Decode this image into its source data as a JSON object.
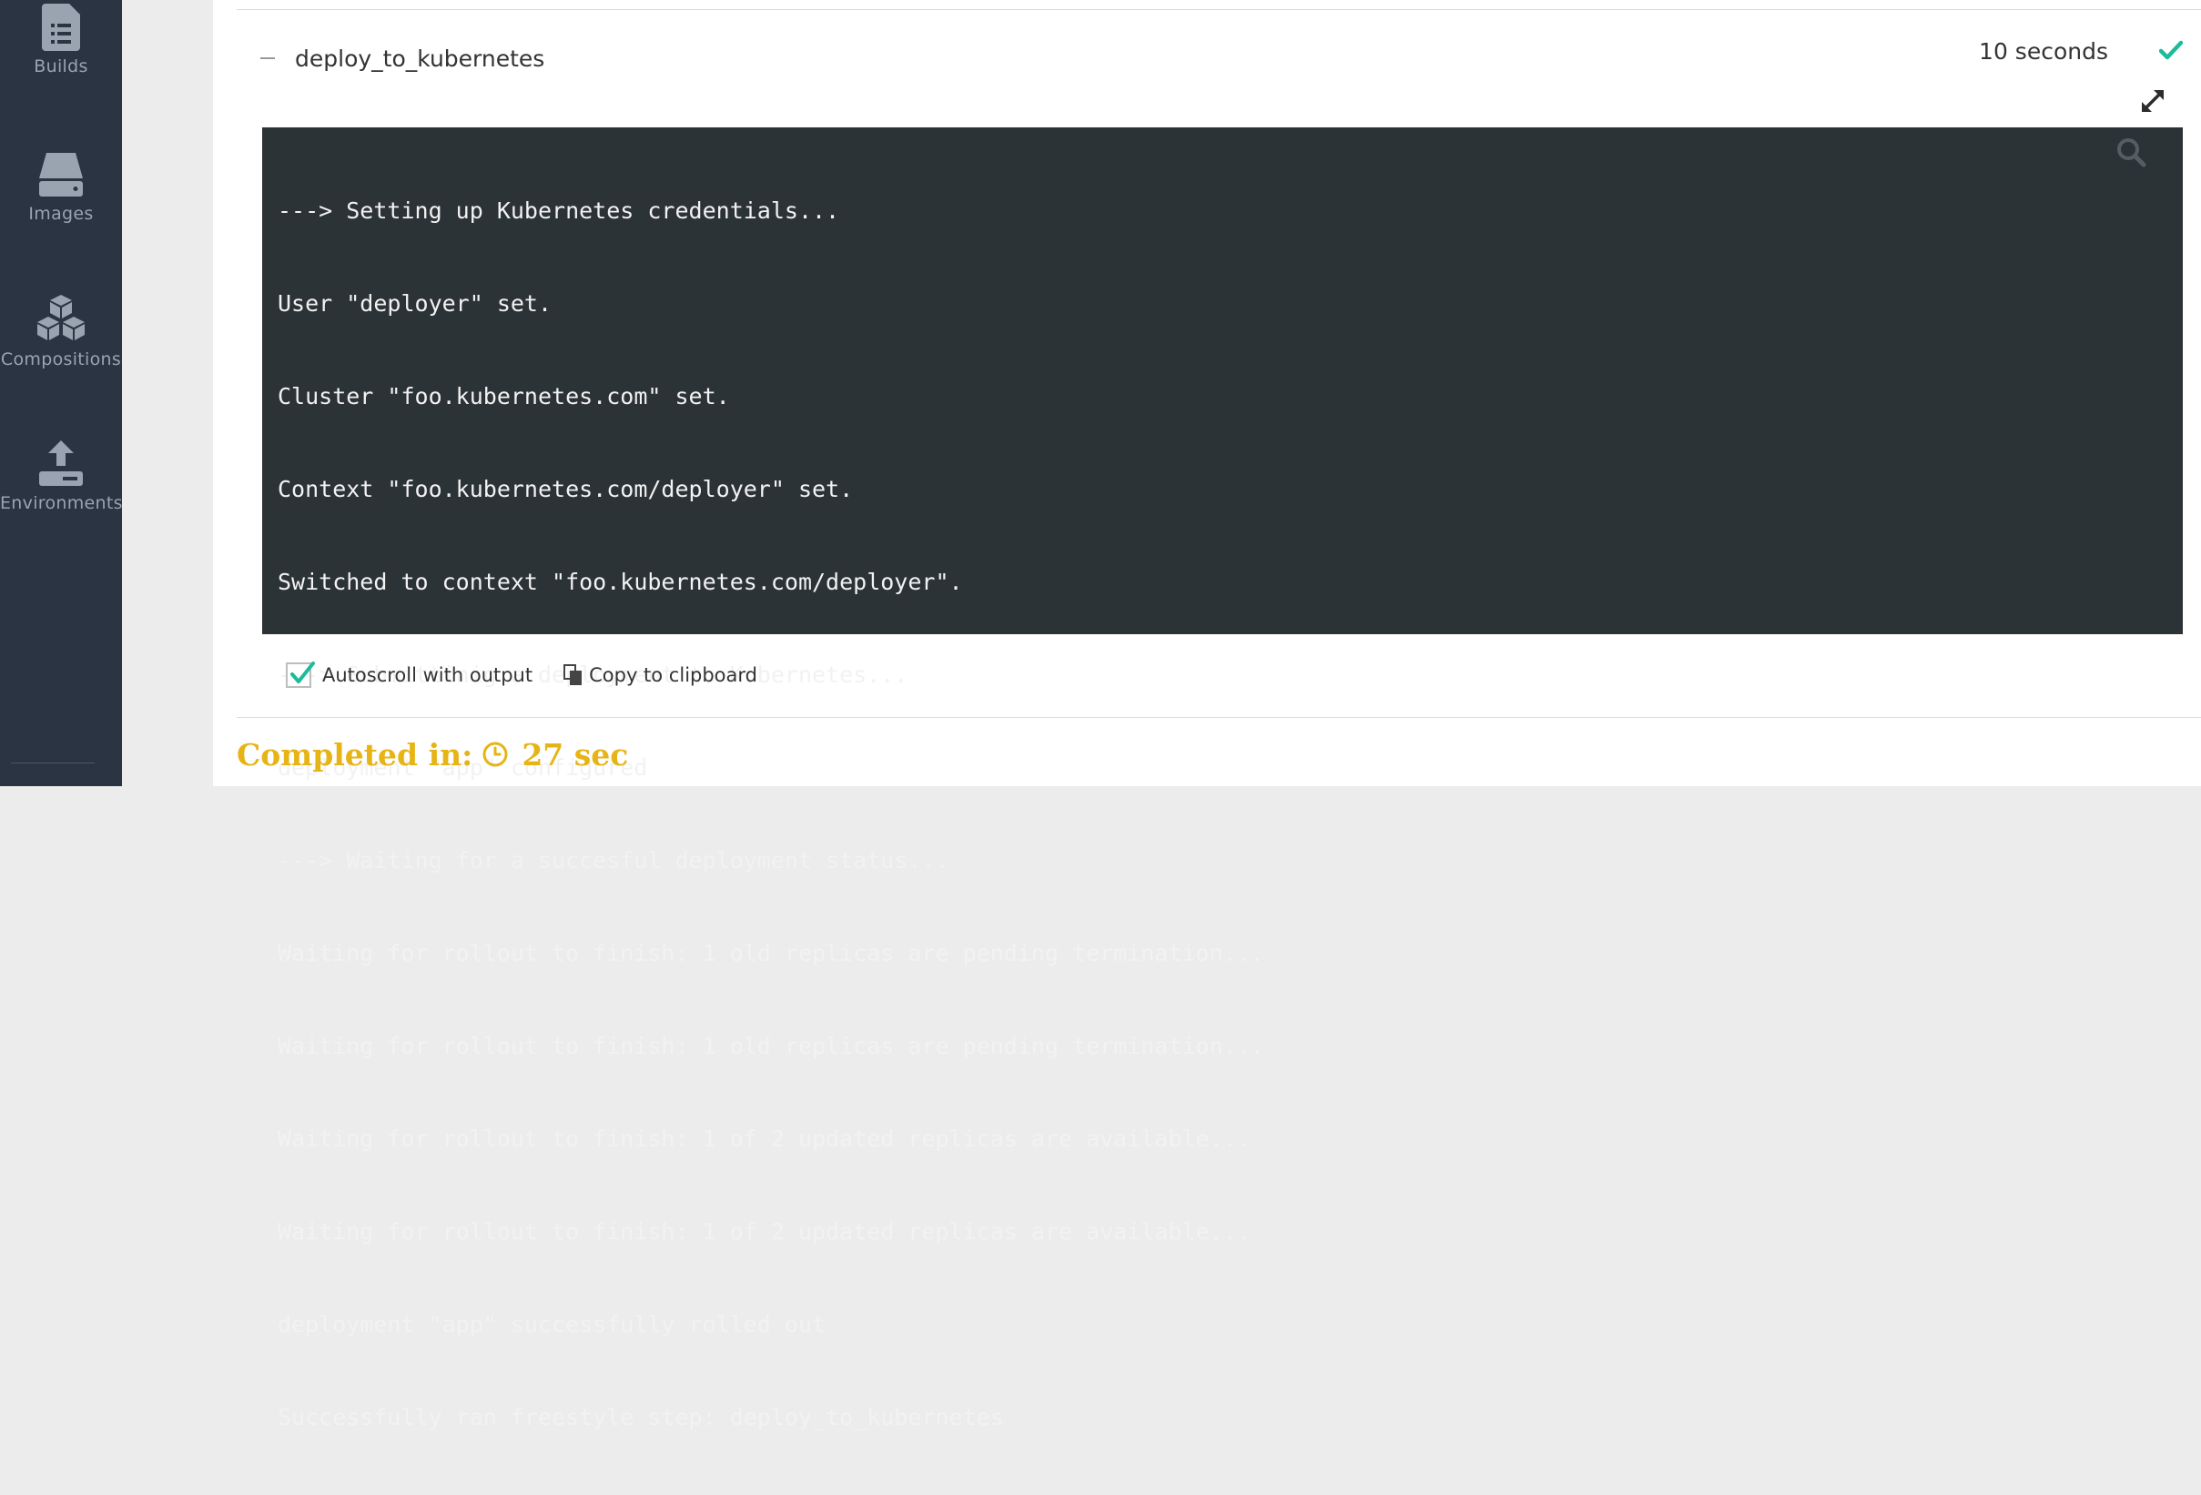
{
  "sidebar": {
    "items": [
      {
        "label": "Builds",
        "icon": "builds-icon"
      },
      {
        "label": "Images",
        "icon": "images-icon"
      },
      {
        "label": "Compositions",
        "icon": "compositions-icon"
      },
      {
        "label": "Environments",
        "icon": "environments-icon"
      }
    ]
  },
  "step": {
    "name": "deploy_to_kubernetes",
    "duration": "10 seconds",
    "status": "success",
    "status_color": "#1abc9c"
  },
  "terminal": {
    "lines": [
      "---> Setting up Kubernetes credentials...",
      "User \"deployer\" set.",
      "Cluster \"foo.kubernetes.com\" set.",
      "Context \"foo.kubernetes.com/deployer\" set.",
      "Switched to context \"foo.kubernetes.com/deployer\".",
      "---> Submittinig a deployment to Kubernetes...",
      "deployment \"app\" configured",
      "---> Waiting for a succesful deployment status...",
      "Waiting for rollout to finish: 1 old replicas are pending termination...",
      "Waiting for rollout to finish: 1 old replicas are pending termination...",
      "Waiting for rollout to finish: 1 of 2 updated replicas are available...",
      "Waiting for rollout to finish: 1 of 2 updated replicas are available...",
      "deployment \"app\" successfully rolled out",
      "Successfully ran freestyle step: deploy_to_kubernetes"
    ]
  },
  "controls": {
    "autoscroll_label": "Autoscroll with output",
    "autoscroll_checked": true,
    "copy_label": "Copy to clipboard"
  },
  "summary": {
    "completed_label": "Completed in:",
    "completed_value": "27 sec",
    "accent_color": "#e7b416"
  }
}
